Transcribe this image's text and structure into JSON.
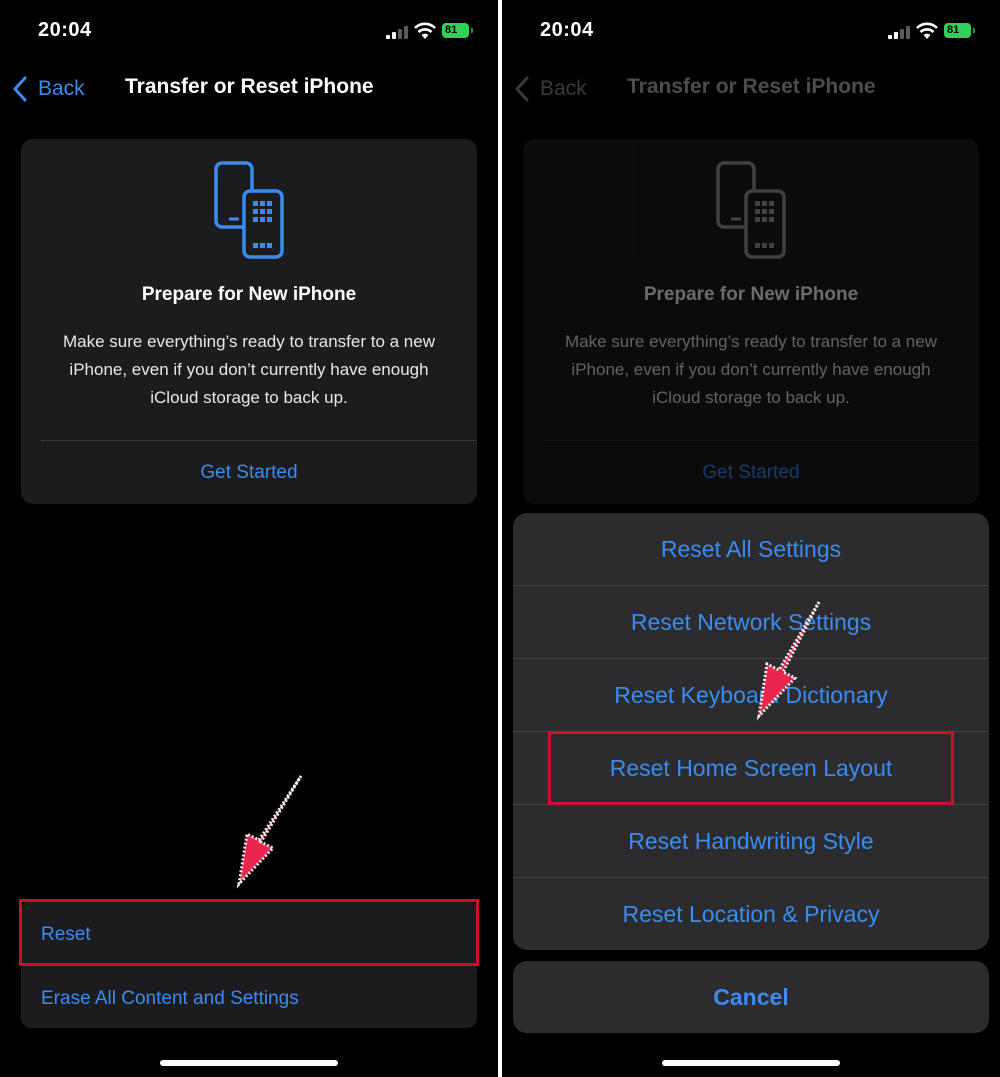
{
  "status_bar": {
    "time": "20:04",
    "battery": "81"
  },
  "nav": {
    "back_label": "Back",
    "title": "Transfer or Reset iPhone"
  },
  "card": {
    "title": "Prepare for New iPhone",
    "description": "Make sure everything’s ready to transfer to a new iPhone, even if you don’t currently have enough iCloud storage to back up.",
    "action": "Get Started"
  },
  "options": [
    "Reset",
    "Erase All Content and Settings"
  ],
  "action_sheet": {
    "items": [
      "Reset All Settings",
      "Reset Network Settings",
      "Reset Keyboard Dictionary",
      "Reset Home Screen Layout",
      "Reset Handwriting Style",
      "Reset Location & Privacy"
    ],
    "cancel": "Cancel"
  },
  "colors": {
    "accent": "#3a8cf0",
    "highlight": "#c8102e",
    "arrow": "#e8254a",
    "background": "#000000"
  },
  "icons": [
    "back-chevron-icon",
    "cellular-signal-icon",
    "wifi-icon",
    "battery-icon",
    "transfer-phones-icon",
    "pointer-arrow-icon"
  ]
}
